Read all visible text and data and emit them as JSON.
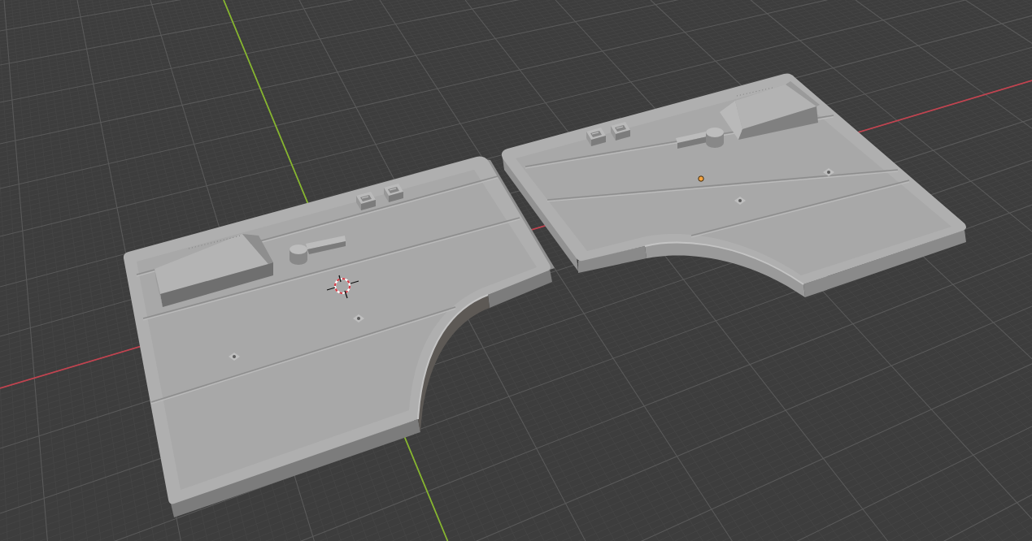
{
  "viewport": {
    "show_x_axis": true,
    "show_y_axis": true,
    "objects": [
      {
        "kind": "left-plate",
        "selected": false
      },
      {
        "kind": "right-plate",
        "selected": true
      }
    ],
    "show_cursor": true
  }
}
